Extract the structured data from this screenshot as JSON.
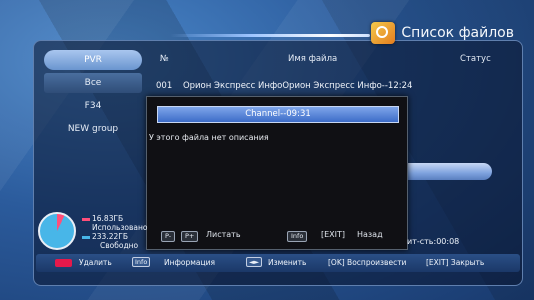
{
  "title": "Список файлов",
  "sidebar": {
    "items": [
      {
        "label": "PVR",
        "state": "active"
      },
      {
        "label": "Все",
        "state": "selected"
      },
      {
        "label": "F34",
        "state": "normal"
      },
      {
        "label": "NEW group",
        "state": "normal"
      }
    ]
  },
  "table": {
    "headers": {
      "num": "№",
      "name": "Имя файла",
      "status": "Статус"
    },
    "rows": [
      {
        "num": "001",
        "name": "Орион Экспресс ИнфоОрион Экспресс Инфо--12:24"
      }
    ]
  },
  "dialog": {
    "title": "Channel--09:31",
    "description": "У этого файла нет описания",
    "keys": {
      "prev": "P-",
      "next": "P+",
      "scroll": "Листать",
      "info": "Info",
      "exit": "[EXIT]",
      "back": "Назад"
    }
  },
  "storage": {
    "free_label": "16.83ГБ",
    "used_text": "Использовано",
    "total_label": "233.22ГБ",
    "free_text": "Свободно",
    "used_color": "#ff4f7a",
    "free_color": "#48b6e8"
  },
  "duration": "ит-сть:00:08",
  "bottom_bar": {
    "delete": "Удалить",
    "info_key": "Info",
    "info": "Информация",
    "change_key": "◄►",
    "change": "Изменить",
    "play": "[OK] Воспроизвести",
    "close": "[EXIT] Закрыть"
  }
}
